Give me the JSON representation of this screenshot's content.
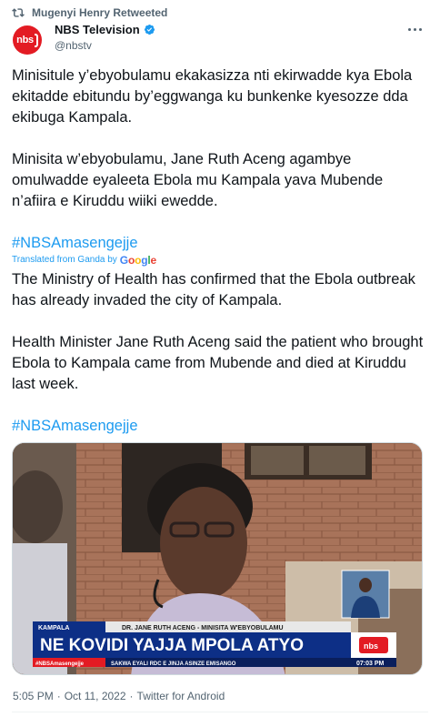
{
  "retweet": {
    "icon": "retweet-icon",
    "text": "Mugenyi Henry Retweeted"
  },
  "author": {
    "avatar_text": "nbs",
    "name": "NBS Television",
    "handle": "@nbstv",
    "verified_icon": "verified-badge-icon"
  },
  "tweet": {
    "paragraph1": "Minisitule y’ebyobulamu ekakasizza nti ekirwadde kya Ebola ekitadde ebitundu by’eggwanga ku bunkenke kyesozze dda ekibuga  Kampala.",
    "paragraph2": "Minisita w’ebyobulamu, Jane Ruth Aceng agambye omulwadde eyaleeta Ebola mu Kampala yava Mubende n’afiira e Kiruddu wiiki ewedde.",
    "hashtag1": "#NBSAmasengejje",
    "translated_label": "Translated from Ganda by",
    "translated_brand": "Google",
    "translation1": "The Ministry of Health has confirmed that the Ebola outbreak has already invaded the city of Kampala.",
    "translation2": "Health Minister Jane Ruth Aceng said the patient who brought Ebola to Kampala came from Mubende and died at Kiruddu last week.",
    "hashtag2": "#NBSAmasengejje"
  },
  "media": {
    "location_tag": "KAMPALA",
    "name_strap": "DR. JANE RUTH ACENG - MINISITA W'EBYOBULAMU",
    "headline": "NE KOVIDI YAJJA MPOLA ATYO",
    "hashtag_strap": "#NBSAmasengejje",
    "ticker": "SAKWA EYALI RDC E JINJA ASINZE EMISANGO",
    "logo": "nbs",
    "time": "07:03 PM"
  },
  "meta": {
    "time": "5:05 PM",
    "sep1": "·",
    "date": "Oct 11, 2022",
    "sep2": "·",
    "source": "Twitter for Android"
  },
  "colors": {
    "link": "#1d9bf0",
    "secondary_text": "#536471",
    "brand_red": "#e31b23",
    "headline_blue": "#0d2f86"
  }
}
